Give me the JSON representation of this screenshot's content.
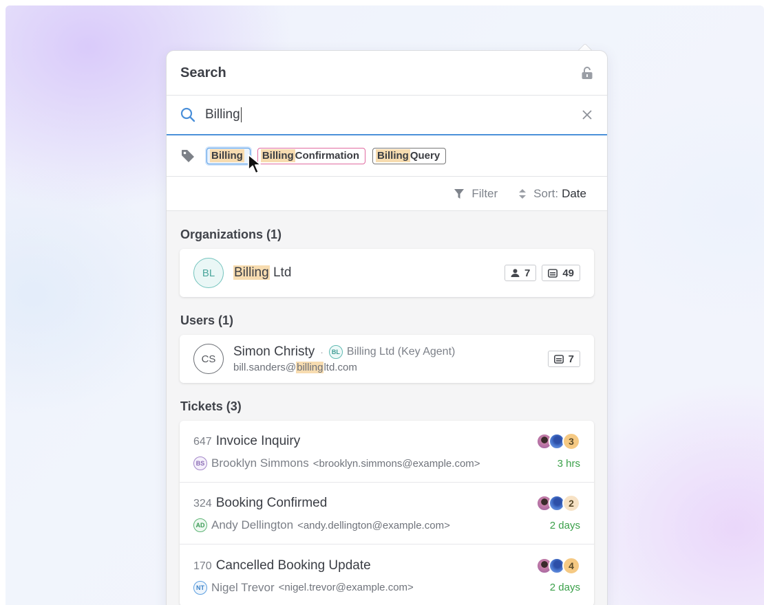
{
  "header": {
    "title": "Search",
    "lock_icon": "unlock-icon"
  },
  "search": {
    "value": "Billing",
    "icon": "search-icon",
    "clear_icon": "close-icon"
  },
  "tags": {
    "icon": "tag-icon",
    "items": [
      {
        "highlight": "Billing",
        "rest": "",
        "style": "selected"
      },
      {
        "highlight": "Billing",
        "rest": " Confirmation",
        "style": "pink"
      },
      {
        "highlight": "Billing",
        "rest": " Query",
        "style": "gray"
      }
    ]
  },
  "toolbar": {
    "filter_label": "Filter",
    "sort_label": "Sort:",
    "sort_value": "Date"
  },
  "organizations": {
    "label": "Organizations (1)",
    "items": [
      {
        "initials": "BL",
        "name_highlight": "Billing",
        "name_rest": " Ltd",
        "users": "7",
        "tickets": "49"
      }
    ]
  },
  "users": {
    "label": "Users (1)",
    "items": [
      {
        "initials": "CS",
        "name": "Simon Christy",
        "dot": "·",
        "org_initials": "BL",
        "org": "Billing Ltd (Key Agent)",
        "email_pre": "bill.sanders@",
        "email_highlight": "billing",
        "email_post": "ltd.com",
        "tickets": "7"
      }
    ]
  },
  "tickets": {
    "label": "Tickets (3)",
    "items": [
      {
        "id": "647",
        "title": "Invoice Inquiry",
        "req_initials": "BS",
        "requester": "Brooklyn Simmons",
        "email": "<brooklyn.simmons@example.com>",
        "count": "3",
        "age": "3 hrs",
        "initials_color": "purple",
        "count_color": "orange"
      },
      {
        "id": "324",
        "title": "Booking Confirmed",
        "req_initials": "AD",
        "requester": "Andy Dellington",
        "email": "<andy.dellington@example.com>",
        "count": "2",
        "age": "2 days",
        "initials_color": "green",
        "count_color": "light"
      },
      {
        "id": "170",
        "title": "Cancelled Booking Update",
        "req_initials": "NT",
        "requester": "Nigel Trevor",
        "email": "<nigel.trevor@example.com>",
        "count": "4",
        "age": "2 days",
        "initials_color": "blue",
        "count_color": "orange"
      }
    ]
  },
  "colors": {
    "accent": "#4a90d9",
    "highlight": "#f7dcb0",
    "age_green": "#3aa049"
  }
}
